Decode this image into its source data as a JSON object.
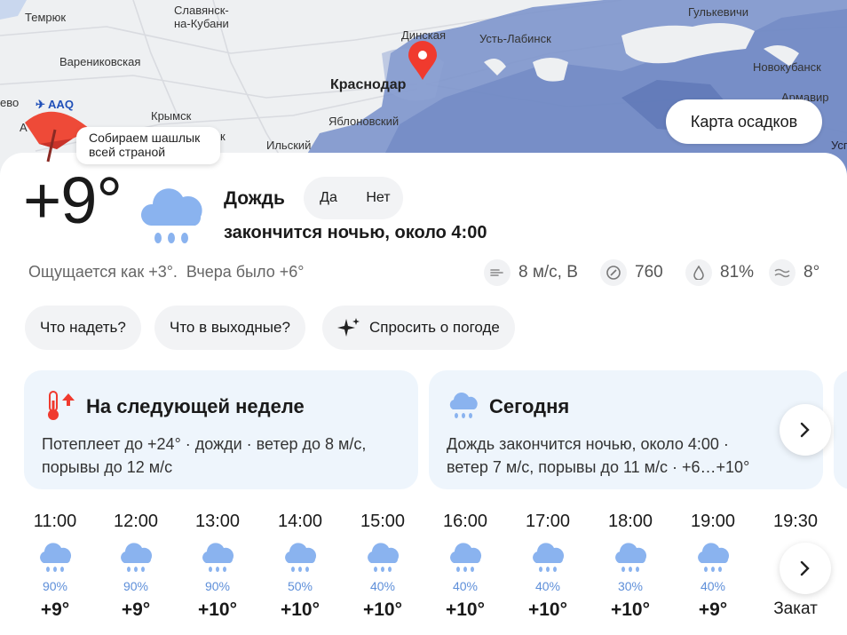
{
  "map": {
    "labels": {
      "temryuk": "Темрюк",
      "slavyansk": "Славянск-\nна-Кубани",
      "gulkevichi": "Гулькевичи",
      "dinskaya": "Динская",
      "ust_labinsk": "Усть-Лабинск",
      "varenikovskaya": "Варениковская",
      "novokubansk": "Новокубанск",
      "krasnodar": "Краснодар",
      "armavir": "Армавир",
      "anapa_left": "ево",
      "airport": "AAQ",
      "krymsk": "Крымск",
      "yablonovsky": "Яблоновский",
      "ilsky": "Ильский",
      "a_left": "А",
      "k_partial": "к",
      "us_partial": "Усп"
    },
    "precip_button": "Карта осадков",
    "promo": "Собираем шашлык\nвсей страной"
  },
  "current": {
    "temp": "+9°",
    "condition": "Дождь",
    "yes": "Да",
    "no": "Нет",
    "until": "закончится ночью, около 4:00",
    "feels": "Ощущается как +3°.",
    "yesterday": "Вчера было +6°",
    "wind": "8 м/с, В",
    "pressure": "760",
    "humidity": "81%",
    "water": "8°"
  },
  "chips": [
    "Что надеть?",
    "Что в выходные?",
    "Спросить о погоде"
  ],
  "cards": {
    "next_week_title": "На следующей неделе",
    "next_week_text": "Потеплеет до +24° · дожди · ветер до 8 м/с,\nпорывы до 12 м/с",
    "today_title": "Сегодня",
    "today_text": "Дождь закончится ночью, около 4:00 ·\nветер 7 м/с, порывы до 11 м/с · +6…+10°"
  },
  "hourly": [
    {
      "time": "11:00",
      "prob": "90%",
      "temp": "+9°",
      "icon": "rain-cloud-icon"
    },
    {
      "time": "12:00",
      "prob": "90%",
      "temp": "+9°",
      "icon": "rain-cloud-icon"
    },
    {
      "time": "13:00",
      "prob": "90%",
      "temp": "+10°",
      "icon": "rain-cloud-icon"
    },
    {
      "time": "14:00",
      "prob": "50%",
      "temp": "+10°",
      "icon": "rain-cloud-icon"
    },
    {
      "time": "15:00",
      "prob": "40%",
      "temp": "+10°",
      "icon": "rain-cloud-icon"
    },
    {
      "time": "16:00",
      "prob": "40%",
      "temp": "+10°",
      "icon": "rain-cloud-icon"
    },
    {
      "time": "17:00",
      "prob": "40%",
      "temp": "+10°",
      "icon": "rain-cloud-icon"
    },
    {
      "time": "18:00",
      "prob": "30%",
      "temp": "+10°",
      "icon": "rain-cloud-icon"
    },
    {
      "time": "19:00",
      "prob": "40%",
      "temp": "+9°",
      "icon": "rain-cloud-icon"
    },
    {
      "time": "19:30",
      "prob": "",
      "temp": "Закат",
      "icon": "sunset-icon"
    }
  ],
  "colors": {
    "precip_map": "#7d95cc",
    "precip_dark": "#6a82be",
    "accent_red": "#f03a2e",
    "cloud_blue": "#8ab3ef",
    "prob_blue": "#5e8fd9",
    "card_bg": "#eef5fc"
  }
}
